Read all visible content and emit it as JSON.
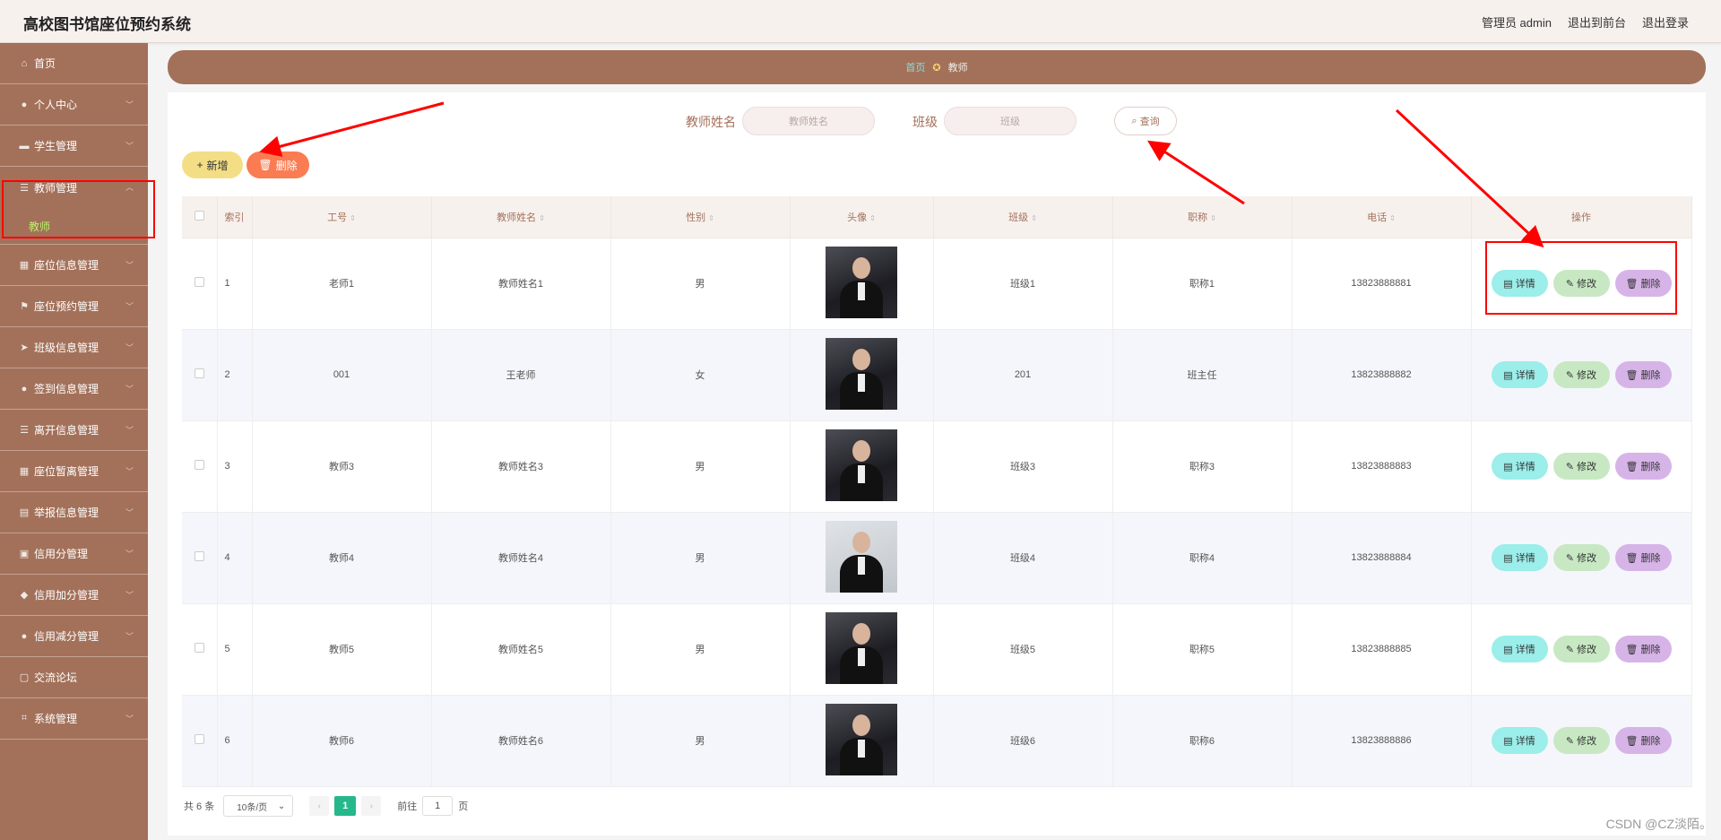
{
  "header": {
    "title": "高校图书馆座位预约系统",
    "user_label": "管理员 admin",
    "front_link": "退出到前台",
    "logout": "退出登录"
  },
  "sidebar": {
    "items": [
      {
        "label": "首页",
        "icon": "home-icon",
        "glyph": "⌂",
        "chevron": false
      },
      {
        "label": "个人中心",
        "icon": "user-icon",
        "glyph": "●",
        "chevron": true
      },
      {
        "label": "学生管理",
        "icon": "id-card-icon",
        "glyph": "▬",
        "chevron": true
      },
      {
        "label": "教师管理",
        "icon": "list-icon",
        "glyph": "☰",
        "chevron": true,
        "expanded": true,
        "sub": "教师"
      },
      {
        "label": "座位信息管理",
        "icon": "table-icon",
        "glyph": "▦",
        "chevron": true
      },
      {
        "label": "座位预约管理",
        "icon": "flag-icon",
        "glyph": "⚑",
        "chevron": true
      },
      {
        "label": "班级信息管理",
        "icon": "send-icon",
        "glyph": "➤",
        "chevron": true
      },
      {
        "label": "签到信息管理",
        "icon": "user-icon",
        "glyph": "●",
        "chevron": true
      },
      {
        "label": "离开信息管理",
        "icon": "list-icon",
        "glyph": "☰",
        "chevron": true
      },
      {
        "label": "座位暂离管理",
        "icon": "table-icon",
        "glyph": "▦",
        "chevron": true
      },
      {
        "label": "举报信息管理",
        "icon": "table-icon",
        "glyph": "▤",
        "chevron": true
      },
      {
        "label": "信用分管理",
        "icon": "card-icon",
        "glyph": "▣",
        "chevron": true
      },
      {
        "label": "信用加分管理",
        "icon": "shield-icon",
        "glyph": "◆",
        "chevron": true
      },
      {
        "label": "信用减分管理",
        "icon": "user-icon",
        "glyph": "●",
        "chevron": true
      },
      {
        "label": "交流论坛",
        "icon": "share-icon",
        "glyph": "▢",
        "chevron": false
      },
      {
        "label": "系统管理",
        "icon": "crop-icon",
        "glyph": "⌗",
        "chevron": true
      }
    ]
  },
  "breadcrumb": {
    "home": "首页",
    "current": "教师"
  },
  "search": {
    "name_label": "教师姓名",
    "name_placeholder": "教师姓名",
    "class_label": "班级",
    "class_placeholder": "班级",
    "query_button": "查询"
  },
  "actions": {
    "add": "新增",
    "delete": "删除"
  },
  "table": {
    "columns": [
      "索引",
      "工号",
      "教师姓名",
      "性别",
      "头像",
      "班级",
      "职称",
      "电话",
      "操作"
    ],
    "rows": [
      {
        "index": "1",
        "id": "老师1",
        "name": "教师姓名1",
        "gender": "男",
        "class": "班级1",
        "title": "职称1",
        "phone": "13823888881"
      },
      {
        "index": "2",
        "id": "001",
        "name": "王老师",
        "gender": "女",
        "class": "201",
        "title": "班主任",
        "phone": "13823888882"
      },
      {
        "index": "3",
        "id": "教师3",
        "name": "教师姓名3",
        "gender": "男",
        "class": "班级3",
        "title": "职称3",
        "phone": "13823888883"
      },
      {
        "index": "4",
        "id": "教师4",
        "name": "教师姓名4",
        "gender": "男",
        "class": "班级4",
        "title": "职称4",
        "phone": "13823888884"
      },
      {
        "index": "5",
        "id": "教师5",
        "name": "教师姓名5",
        "gender": "男",
        "class": "班级5",
        "title": "职称5",
        "phone": "13823888885"
      },
      {
        "index": "6",
        "id": "教师6",
        "name": "教师姓名6",
        "gender": "男",
        "class": "班级6",
        "title": "职称6",
        "phone": "13823888886"
      }
    ],
    "row_actions": {
      "detail": "详情",
      "edit": "修改",
      "delete": "删除"
    }
  },
  "pagination": {
    "total": "共 6 条",
    "page_size": "10条/页",
    "current_page": "1",
    "goto_label": "前往",
    "goto_value": "1",
    "page_suffix": "页"
  },
  "watermark": "CSDN @CZ淡陌。",
  "colors": {
    "sidebar": "#a3715a",
    "accent_green": "#26b88a",
    "annotation_red": "#ff0000"
  }
}
